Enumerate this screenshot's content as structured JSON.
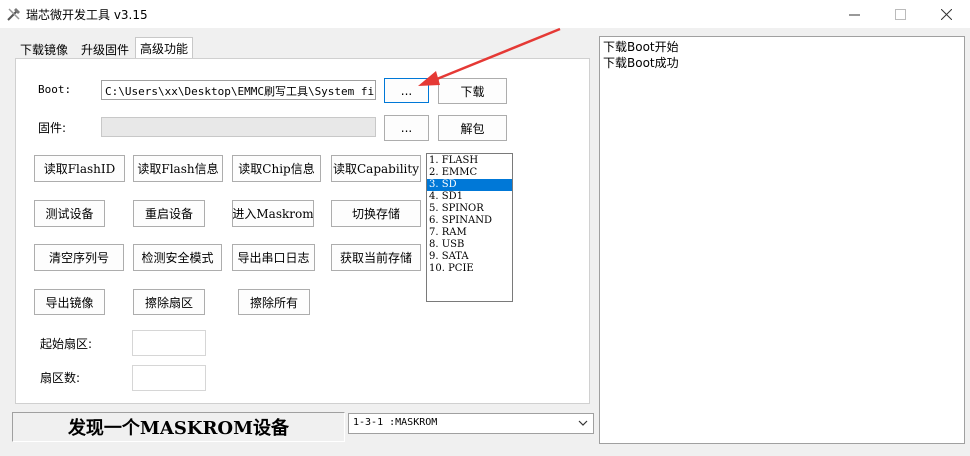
{
  "window": {
    "title": "瑞芯微开发工具 v3.15"
  },
  "tabs": [
    {
      "label": "下载镜像"
    },
    {
      "label": "升级固件"
    },
    {
      "label": "高级功能"
    }
  ],
  "boot": {
    "label": "Boot:",
    "path": "C:\\Users\\xx\\Desktop\\EMMC刷写工具\\System files",
    "browse_label": "...",
    "download_label": "下载"
  },
  "firmware": {
    "label": "固件:",
    "path": "",
    "browse_label": "...",
    "unpack_label": "解包"
  },
  "buttons": {
    "row1": [
      "读取FlashID",
      "读取Flash信息",
      "读取Chip信息",
      "读取Capability"
    ],
    "row2": [
      "测试设备",
      "重启设备",
      "进入Maskrom",
      "切换存储"
    ],
    "row3": [
      "清空序列号",
      "检测安全模式",
      "导出串口日志",
      "获取当前存储"
    ],
    "row4": [
      "导出镜像",
      "擦除扇区",
      "擦除所有"
    ]
  },
  "storage_list": [
    "1.  FLASH",
    "2.  EMMC",
    "3.  SD",
    "4.  SD1",
    "5.  SPINOR",
    "6.  SPINAND",
    "7.  RAM",
    "8.  USB",
    "9.  SATA",
    "10.  PCIE"
  ],
  "storage_selected_index": 2,
  "sector": {
    "start_label": "起始扇区:",
    "start_value": "",
    "count_label": "扇区数:",
    "count_value": ""
  },
  "log_lines": [
    "下载Boot开始",
    "下载Boot成功"
  ],
  "status_text": "发现一个MASKROM设备",
  "device_combo": {
    "value": "1-3-1 :MASKROM"
  },
  "colors": {
    "accent": "#0078d7",
    "annotation_arrow": "#e53935"
  }
}
